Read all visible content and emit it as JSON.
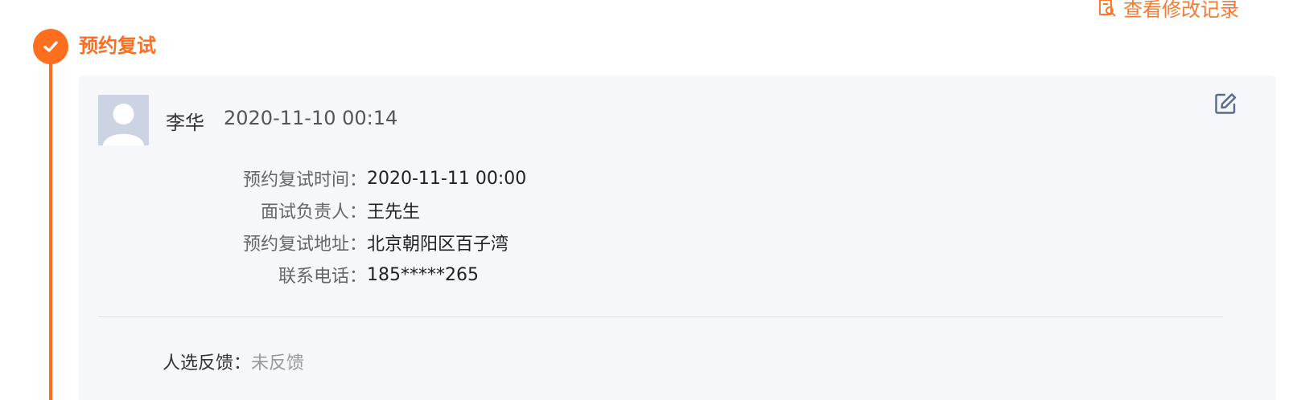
{
  "header": {
    "history_link_label": "查看修改记录"
  },
  "step": {
    "title": "预约复试"
  },
  "record": {
    "author_name": "李华",
    "author_time": "2020-11-10 00:14",
    "details": [
      {
        "label": "预约复试时间：",
        "value": "2020-11-11 00:00"
      },
      {
        "label": "面试负责人：",
        "value": "王先生"
      },
      {
        "label": "预约复试地址：",
        "value": "北京朝阳区百子湾"
      },
      {
        "label": "联系电话：",
        "value": "185*****265"
      }
    ],
    "feedback_label": "人选反馈：",
    "feedback_value": "未反馈"
  },
  "colors": {
    "accent": "#fd6e1f",
    "card_bg": "#f6f7fb",
    "edit_icon": "#5a6a8c"
  },
  "icons": [
    "history-icon",
    "check-icon",
    "avatar-icon",
    "edit-icon"
  ]
}
